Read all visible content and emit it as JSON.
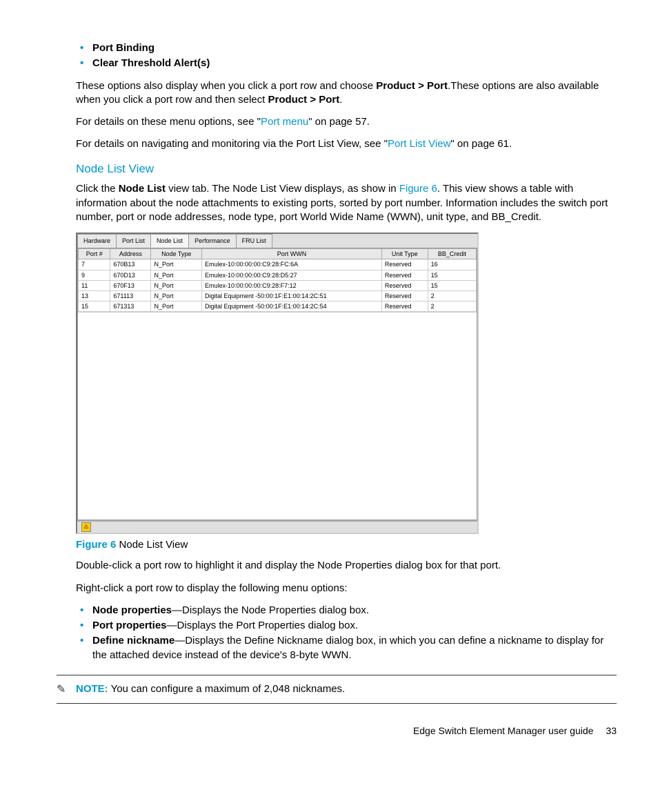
{
  "top_bullets": [
    "Port Binding",
    "Clear Threshold Alert(s)"
  ],
  "para1_a": "These options also display when you click a port row and choose ",
  "para1_b": "Product > Port",
  "para1_c": ".These options are also available when you click a port row and then select ",
  "para1_d": "Product > Port",
  "para1_e": ".",
  "para2_a": "For details on these menu options, see \"",
  "para2_link": "Port menu",
  "para2_b": "\" on page 57.",
  "para3_a": "For details on navigating and monitoring via the Port List View, see \"",
  "para3_link": "Port List View",
  "para3_b": "\" on page 61.",
  "h2": "Node List View",
  "para4_a": "Click the ",
  "para4_b": "Node List",
  "para4_c": " view tab. The Node List View displays, as show in ",
  "para4_link": "Figure 6",
  "para4_d": ". This view shows a table with information about the node attachments to existing ports, sorted by port number. Information includes the switch port number, port or node addresses, node type, port World Wide Name (WWN), unit type, and BB_Credit.",
  "figure": {
    "tabs": [
      "Hardware",
      "Port List",
      "Node List",
      "Performance",
      "FRU List"
    ],
    "active_tab": 2,
    "headers": [
      "Port #",
      "Address",
      "Node Type",
      "Port WWN",
      "Unit Type",
      "BB_Credit"
    ],
    "rows": [
      [
        "7",
        "670B13",
        "N_Port",
        "Emulex-10:00:00:00:C9:28:FC:6A",
        "Reserved",
        "16"
      ],
      [
        "9",
        "670D13",
        "N_Port",
        "Emulex-10:00:00:00:C9:28:D5:27",
        "Reserved",
        "15"
      ],
      [
        "11",
        "670F13",
        "N_Port",
        "Emulex-10:00:00:00:C9:28:F7:12",
        "Reserved",
        "15"
      ],
      [
        "13",
        "671113",
        "N_Port",
        "Digital Equipment -50:00:1F:E1:00:14:2C:51",
        "Reserved",
        "2"
      ],
      [
        "15",
        "671313",
        "N_Port",
        "Digital Equipment -50:00:1F:E1:00:14:2C:54",
        "Reserved",
        "2"
      ]
    ],
    "status_glyph": "⚠"
  },
  "fig_label": "Figure 6",
  "fig_caption": " Node List View",
  "para5": "Double-click a port row to highlight it and display the Node Properties dialog box for that port.",
  "para6": "Right-click a port row to display the following menu options:",
  "menu_bullets": [
    {
      "b": "Node properties",
      "t": "—Displays the Node Properties dialog box."
    },
    {
      "b": "Port properties",
      "t": "—Displays the Port Properties dialog box."
    },
    {
      "b": "Define nickname",
      "t": "—Displays the Define Nickname dialog box, in which you can define a nickname to display for the attached device instead of the device's 8-byte WWN."
    }
  ],
  "note_label": "NOTE:",
  "note_text": "   You can configure a maximum of 2,048 nicknames.",
  "footer_title": "Edge Switch Element Manager user guide",
  "footer_page": "33"
}
